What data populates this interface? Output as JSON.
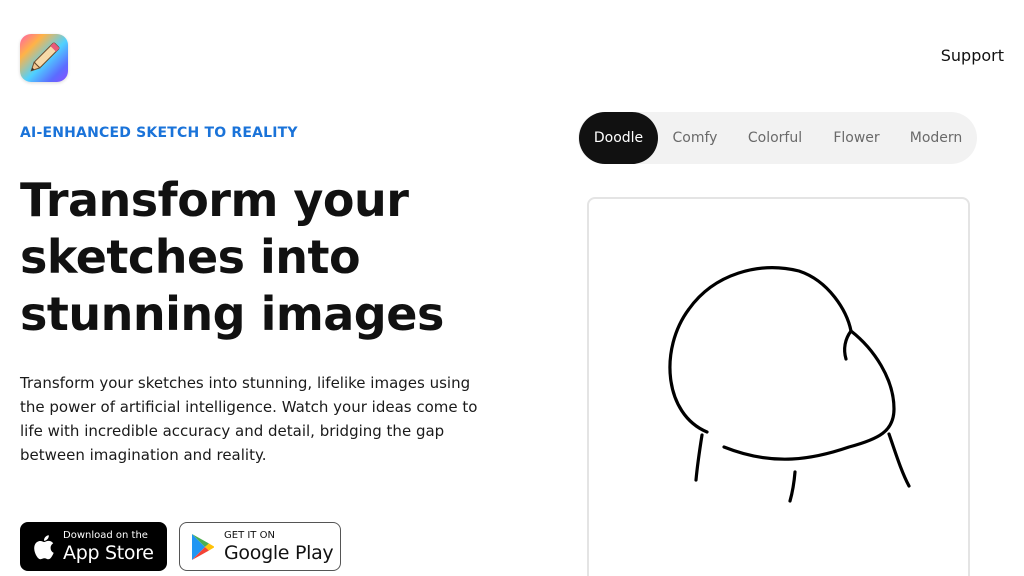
{
  "header": {
    "support_label": "Support"
  },
  "hero": {
    "eyebrow": "AI-ENHANCED SKETCH TO REALITY",
    "headline_lines": [
      "Transform your",
      "sketches into",
      "stunning images"
    ],
    "description_lines": [
      "Transform your sketches into stunning, lifelike images using",
      "the power of artificial intelligence. Watch your ideas come to",
      "life with incredible accuracy and detail, bridging the gap",
      "between imagination and reality."
    ]
  },
  "downloads": {
    "app_store": {
      "small": "Download on the",
      "big": "App Store",
      "icon": "apple-icon"
    },
    "google_play": {
      "small": "GET IT ON",
      "big": "Google Play",
      "icon": "google-play-icon"
    }
  },
  "style_tabs": {
    "items": [
      "Doodle",
      "Comfy",
      "Colorful",
      "Flower",
      "Modern"
    ],
    "selected": "Doodle"
  },
  "colors": {
    "accent": "#1a73d9",
    "tab_active_bg": "#111111",
    "tab_bar_bg": "#f2f2f2"
  }
}
